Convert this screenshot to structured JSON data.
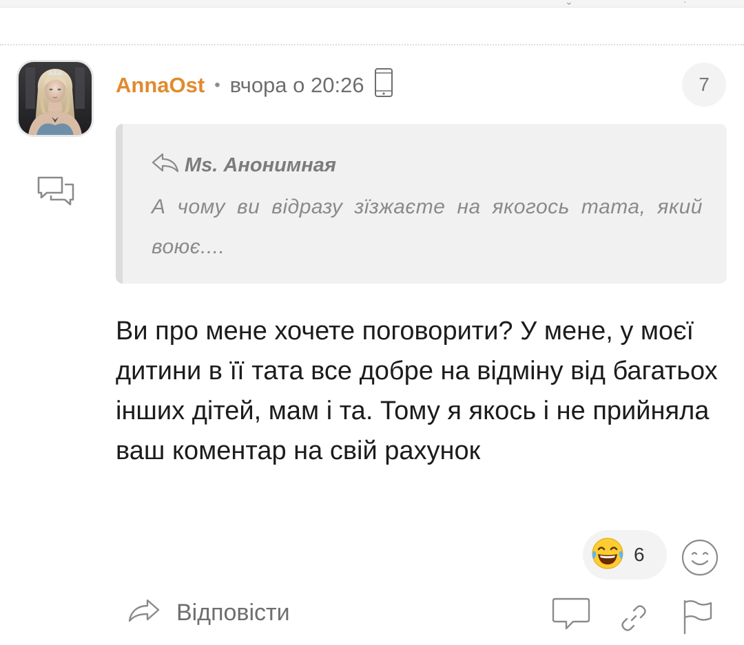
{
  "comment": {
    "author": "AnnaOst",
    "separator": "•",
    "timestamp": "вчора о 20:26",
    "reply_count": "7",
    "quote": {
      "author": "Ms. Анонимная",
      "text": "А чому ви відразу зїзжаєте на якогось тата, який воює...."
    },
    "body": "Ви про мене хочете поговорити? У мене, у моєї дитини в її тата все добре на відміну від багатьох інших дітей, мам і та. Тому я якось і не прийняла ваш коментар на свій рахунок",
    "reactions": [
      {
        "emoji": "laughing-tears",
        "count": "6"
      }
    ]
  },
  "actions": {
    "reply_label": "Відповісти"
  },
  "colors": {
    "author": "#e08a2e",
    "quote_bg": "#f1f1f1",
    "quote_bar": "#dcdcdc",
    "muted": "#8a8a8a"
  },
  "icons": {
    "device": "smartphone-icon",
    "comments": "comments-icon",
    "reply": "reply-arrow-icon",
    "add_reaction": "smiley-icon",
    "comment": "comment-bubble-icon",
    "link": "link-icon",
    "report": "flag-icon"
  }
}
